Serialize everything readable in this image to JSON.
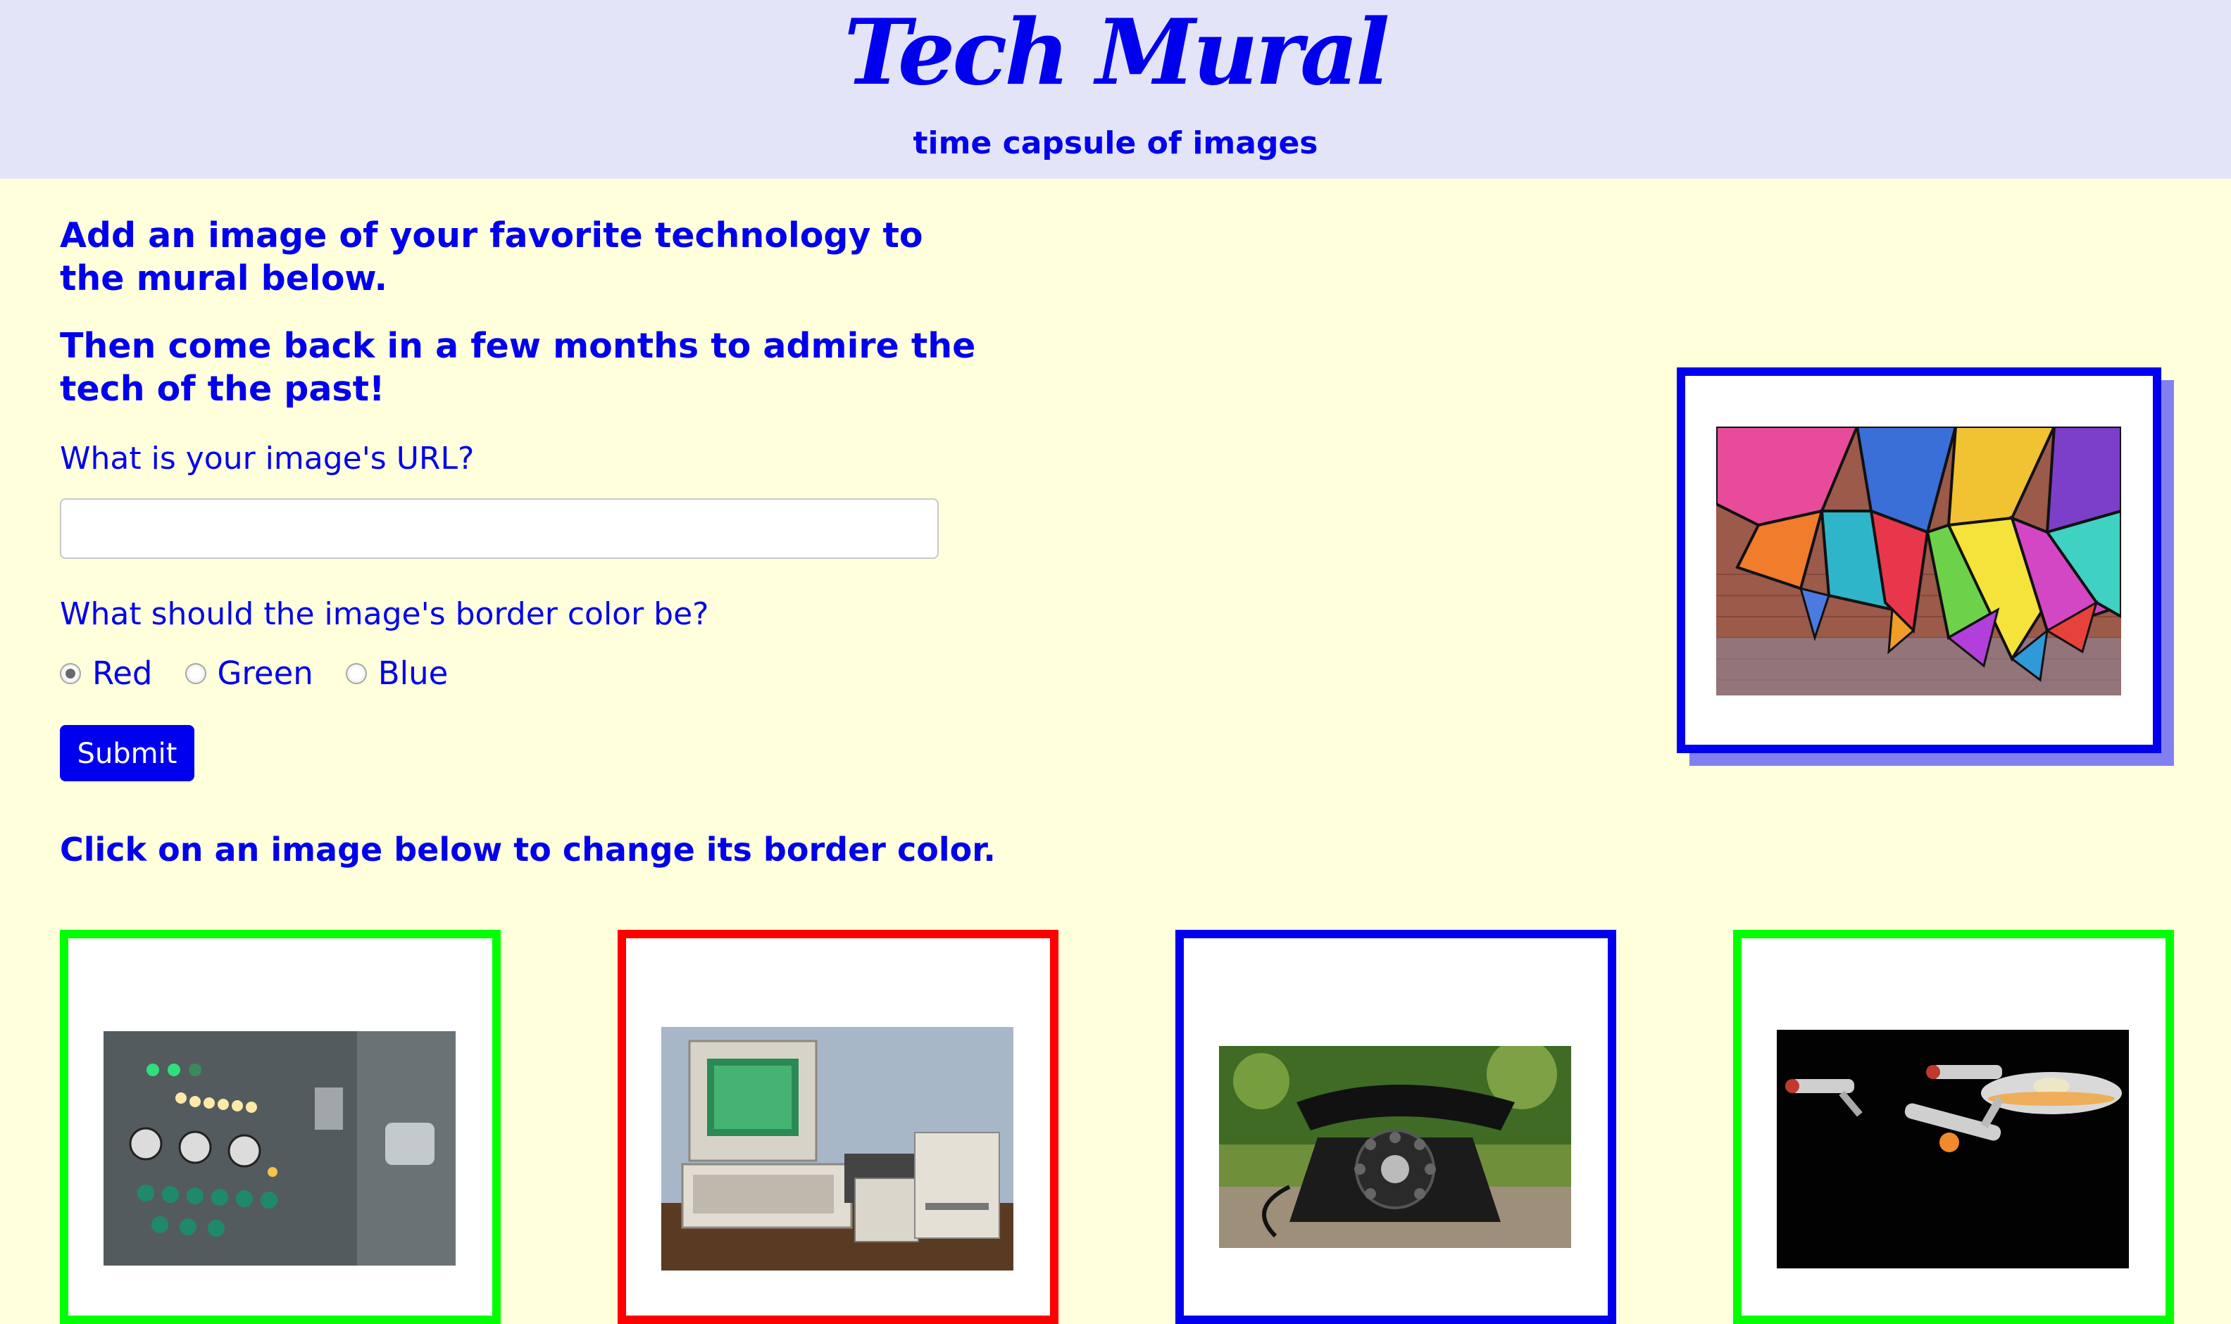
{
  "header": {
    "title": "Tech Mural",
    "subtitle": "time capsule of images",
    "background_color": "#e4e4f8"
  },
  "intro": {
    "line1": "Add an image of your favorite technology to the mural below.",
    "line2": "Then come back in a few months to admire the tech of the past!"
  },
  "form": {
    "url_label": "What is your image's URL?",
    "url_value": "",
    "color_label": "What should the image's border color be?",
    "color_options": [
      {
        "label": "Red",
        "checked": true
      },
      {
        "label": "Green",
        "checked": false
      },
      {
        "label": "Blue",
        "checked": false
      }
    ],
    "submit_label": "Submit"
  },
  "preview": {
    "border_color": "#0000ee",
    "image": "colorful-graffiti-wall"
  },
  "mural": {
    "instruction": "Click on an image below to change its border color.",
    "images": [
      {
        "subject": "vintage-control-panel",
        "border_color": "#00ff00"
      },
      {
        "subject": "retro-computer",
        "border_color": "#ff0000"
      },
      {
        "subject": "rotary-telephone",
        "border_color": "#0000ee"
      },
      {
        "subject": "starship-model",
        "border_color": "#00ff00"
      }
    ]
  },
  "theme": {
    "page_background": "#ffffdb",
    "accent": "#0000ee"
  }
}
